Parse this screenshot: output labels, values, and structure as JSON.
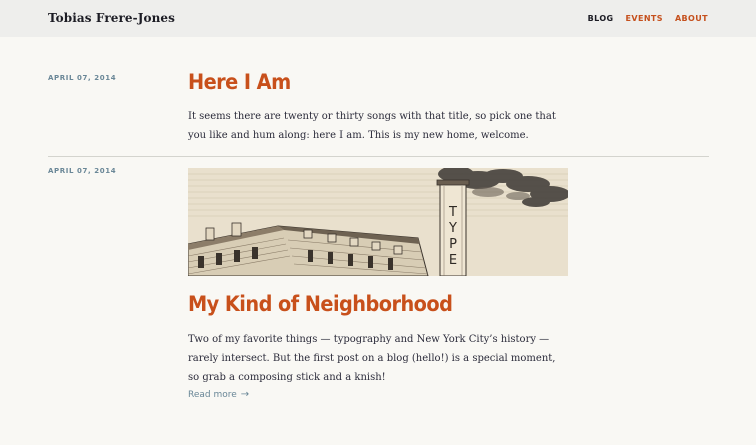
{
  "site": {
    "title": "Tobias Frere-Jones"
  },
  "nav": {
    "items": [
      {
        "label": "BLOG",
        "active": true
      },
      {
        "label": "EVENTS",
        "active": false
      },
      {
        "label": "ABOUT",
        "active": false
      }
    ]
  },
  "posts": [
    {
      "date": "APRIL 07, 2014",
      "title": "Here I Am",
      "body": "It seems there are twenty or thirty songs with that title, so pick one that you like and hum along: here I am. This is my new home, welcome."
    },
    {
      "date": "APRIL 07, 2014",
      "image": {
        "sign_text": "TYPE",
        "subject": "engraving of a factory building with a smokestack"
      },
      "title": "My Kind of Neighborhood",
      "body": "Two of my favorite things — typography and New York City’s history — rarely intersect. But the first post on a blog (hello!) is a special moment, so grab a composing stick and a knish!",
      "read_more": "Read more",
      "arrow_icon": "arrow-right-icon"
    }
  ],
  "colors": {
    "accent": "#c8501b",
    "date": "#6a8797",
    "background": "#f9f8f4",
    "header": "#eeeeec"
  }
}
